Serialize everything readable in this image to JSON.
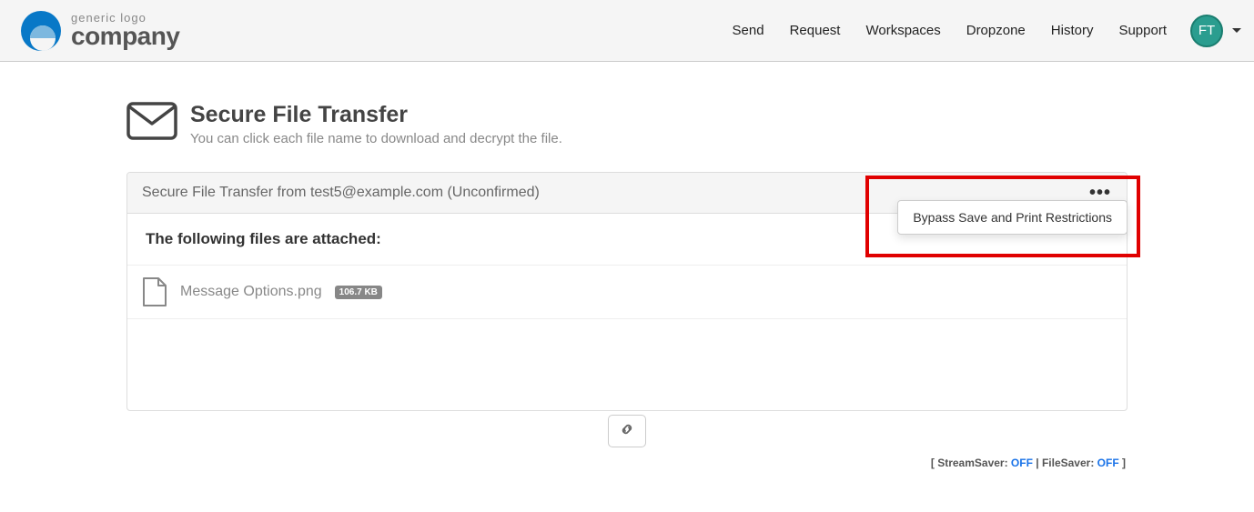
{
  "logo": {
    "top": "generic logo",
    "bottom": "company"
  },
  "nav": {
    "items": [
      "Send",
      "Request",
      "Workspaces",
      "Dropzone",
      "History",
      "Support"
    ]
  },
  "avatar": {
    "initials": "FT"
  },
  "page": {
    "title": "Secure File Transfer",
    "subtitle": "You can click each file name to download and decrypt the file."
  },
  "panel": {
    "header": "Secure File Transfer from test5@example.com (Unconfirmed)",
    "attached_label": "The following files are attached:"
  },
  "file": {
    "name": "Message Options.png",
    "size": "106.7 KB"
  },
  "status": {
    "prefix": "[ ",
    "stream_label": "StreamSaver: ",
    "stream_value": "OFF",
    "sep": " | ",
    "file_label": "FileSaver: ",
    "file_value": "OFF",
    "suffix": " ]"
  },
  "menu": {
    "bypass": "Bypass Save and Print Restrictions"
  }
}
